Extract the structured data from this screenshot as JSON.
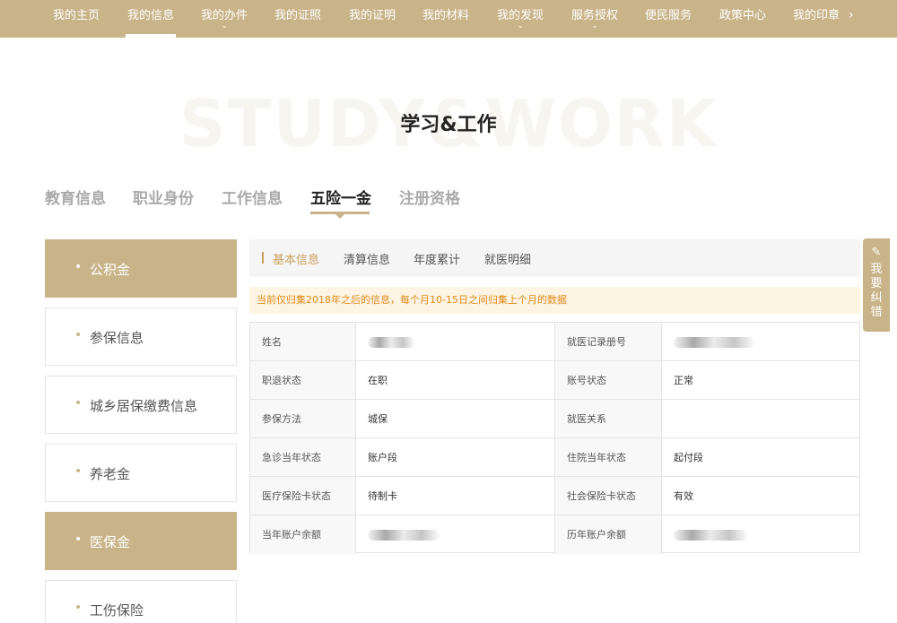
{
  "nav": {
    "items": [
      {
        "label": "我的主页"
      },
      {
        "label": "我的信息"
      },
      {
        "label": "我的办件"
      },
      {
        "label": "我的证照"
      },
      {
        "label": "我的证明"
      },
      {
        "label": "我的材料"
      },
      {
        "label": "我的发现"
      },
      {
        "label": "服务授权"
      },
      {
        "label": "便民服务"
      },
      {
        "label": "政策中心"
      },
      {
        "label": "我的印章"
      }
    ],
    "active": "我的信息",
    "more_glyph": "›"
  },
  "section": {
    "watermark": "STUDY&WORK",
    "title": "学习&工作"
  },
  "tabs": [
    {
      "label": "教育信息"
    },
    {
      "label": "职业身份"
    },
    {
      "label": "工作信息"
    },
    {
      "label": "五险一金"
    },
    {
      "label": "注册资格"
    }
  ],
  "active_tab": "五险一金",
  "sidebar": [
    {
      "label": "公积金"
    },
    {
      "label": "参保信息"
    },
    {
      "label": "城乡居保缴费信息"
    },
    {
      "label": "养老金"
    },
    {
      "label": "医保金"
    },
    {
      "label": "工伤保险"
    }
  ],
  "subtabs": [
    {
      "label": "基本信息"
    },
    {
      "label": "清算信息"
    },
    {
      "label": "年度累计"
    },
    {
      "label": "就医明细"
    }
  ],
  "notice": "当前仅归集2018年之后的信息，每个月10-15日之间归集上个月的数据",
  "table": {
    "rows": [
      {
        "l1": "姓名",
        "v1": "",
        "l2": "就医记录册号",
        "v2": ""
      },
      {
        "l1": "职退状态",
        "v1": "在职",
        "l2": "账号状态",
        "v2": "正常"
      },
      {
        "l1": "参保方法",
        "v1": "城保",
        "l2": "就医关系",
        "v2": ""
      },
      {
        "l1": "急诊当年状态",
        "v1": "账户段",
        "l2": "住院当年状态",
        "v2": "起付段"
      },
      {
        "l1": "医疗保险卡状态",
        "v1": "待制卡",
        "l2": "社会保险卡状态",
        "v2": "有效"
      },
      {
        "l1": "当年账户余额",
        "v1": "",
        "l2": "历年账户余额",
        "v2": ""
      }
    ]
  },
  "feedback": {
    "icon": "pencil-icon",
    "label": "我要纠错"
  },
  "colors": {
    "brand": "#c9b489",
    "accent_text": "#c9a15e",
    "notice_bg": "#fdf4e3",
    "notice_text": "#e08a1e"
  }
}
